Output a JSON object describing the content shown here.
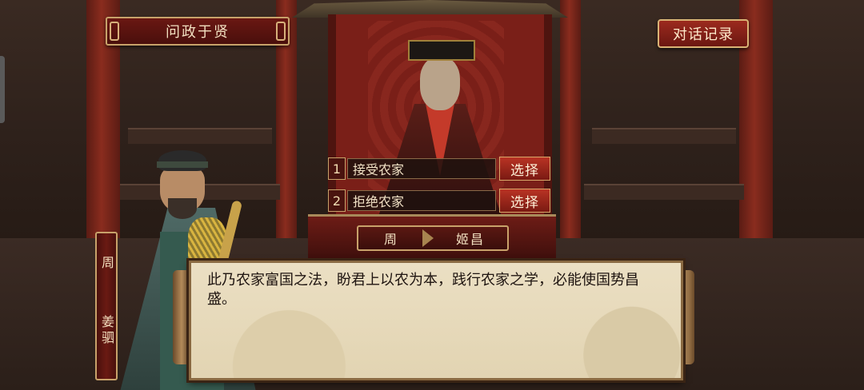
{
  "header": {
    "title": "问政于贤",
    "log_button": "对话记录"
  },
  "choices": [
    {
      "number": "1",
      "label": "接受农家",
      "action": "选择"
    },
    {
      "number": "2",
      "label": "拒绝农家",
      "action": "选择"
    }
  ],
  "ruler": {
    "kingdom": "周",
    "name": "姬昌"
  },
  "speaker": {
    "kingdom": "周",
    "name": "姜驷"
  },
  "dialog": {
    "text": "此乃农家富国之法，盼君上以农为本，践行农家之学，必能使国势昌盛。"
  }
}
